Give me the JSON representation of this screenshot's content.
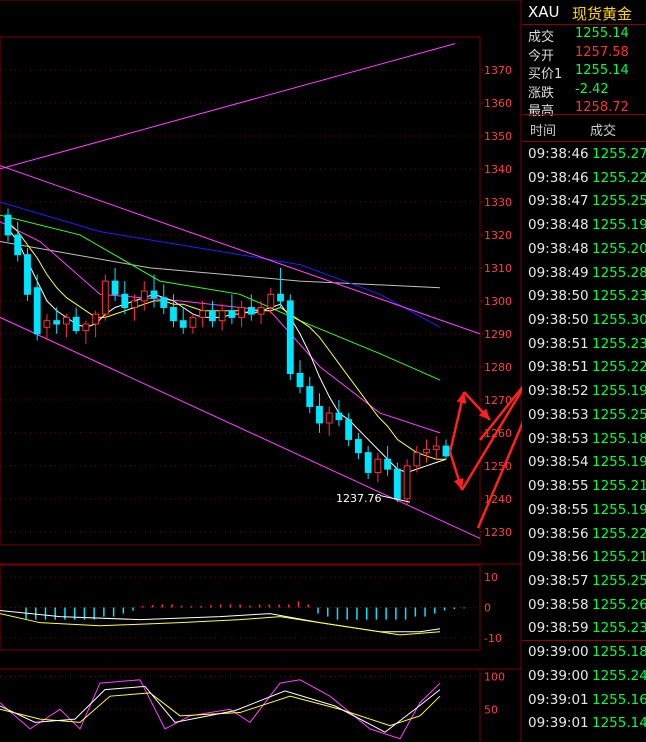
{
  "colors": {
    "up": "#ff3030",
    "down": "#00e5ff",
    "grid": "#7a0000",
    "axis_text": "#ff4040",
    "channel": "#ff40ff",
    "ma5": "#ffffff",
    "ma10": "#ffff40",
    "ma20": "#ff40ff",
    "ma30": "#30ff30",
    "ma60": "#2020ff",
    "ma120": "#c0c0c0",
    "arrow": "#ff2020",
    "value_green": "#00ff40",
    "value_red": "#ff3030"
  },
  "quote": {
    "symbol": "XAU",
    "name": "现货黄金",
    "rows": [
      {
        "label": "成交",
        "value": "1255.14",
        "color": "#00ff40"
      },
      {
        "label": "今开",
        "value": "1257.58",
        "color": "#ff3030"
      },
      {
        "label": "买价1",
        "value": "1255.14",
        "color": "#00ff40"
      },
      {
        "label": "涨跌",
        "value": "-2.42",
        "color": "#00ff40"
      },
      {
        "label": "最高",
        "value": "1258.72",
        "color": "#ff3030"
      }
    ]
  },
  "trades": {
    "header_time": "时间",
    "header_price": "成交",
    "rows": [
      {
        "time": "09:38:46",
        "price": "1255.27"
      },
      {
        "time": "09:38:46",
        "price": "1255.22"
      },
      {
        "time": "09:38:47",
        "price": "1255.25"
      },
      {
        "time": "09:38:48",
        "price": "1255.19"
      },
      {
        "time": "09:38:48",
        "price": "1255.20"
      },
      {
        "time": "09:38:49",
        "price": "1255.28"
      },
      {
        "time": "09:38:50",
        "price": "1255.23"
      },
      {
        "time": "09:38:50",
        "price": "1255.30"
      },
      {
        "time": "09:38:51",
        "price": "1255.23"
      },
      {
        "time": "09:38:51",
        "price": "1255.22"
      },
      {
        "time": "09:38:52",
        "price": "1255.19"
      },
      {
        "time": "09:38:53",
        "price": "1255.25"
      },
      {
        "time": "09:38:53",
        "price": "1255.18"
      },
      {
        "time": "09:38:54",
        "price": "1255.19"
      },
      {
        "time": "09:38:55",
        "price": "1255.21"
      },
      {
        "time": "09:38:55",
        "price": "1255.19"
      },
      {
        "time": "09:38:56",
        "price": "1255.22"
      },
      {
        "time": "09:38:56",
        "price": "1255.21"
      },
      {
        "time": "09:38:57",
        "price": "1255.25"
      },
      {
        "time": "09:38:58",
        "price": "1255.26"
      },
      {
        "time": "09:38:59",
        "price": "1255.23"
      },
      {
        "time": "09:39:00",
        "price": "1255.18"
      },
      {
        "time": "09:39:00",
        "price": "1255.24"
      },
      {
        "time": "09:39:01",
        "price": "1255.16"
      },
      {
        "time": "09:39:01",
        "price": "1255.14"
      }
    ]
  },
  "chart_data": [
    {
      "type": "candlestick",
      "ylim": [
        1226,
        1380
      ],
      "yticks": [
        1230,
        1240,
        1250,
        1260,
        1270,
        1280,
        1290,
        1300,
        1310,
        1320,
        1330,
        1340,
        1350,
        1360,
        1370
      ],
      "grid": true,
      "annotation": {
        "text": "1237.76",
        "price": 1237.76
      },
      "candles": [
        [
          1326,
          1328,
          1318,
          1320
        ],
        [
          1320,
          1324,
          1312,
          1314
        ],
        [
          1314,
          1316,
          1300,
          1302
        ],
        [
          1304,
          1308,
          1288,
          1290
        ],
        [
          1292,
          1296,
          1288,
          1294
        ],
        [
          1294,
          1298,
          1290,
          1293
        ],
        [
          1293,
          1296,
          1289,
          1295
        ],
        [
          1295,
          1298,
          1290,
          1291
        ],
        [
          1291,
          1294,
          1287,
          1293
        ],
        [
          1293,
          1297,
          1289,
          1296
        ],
        [
          1296,
          1308,
          1294,
          1306
        ],
        [
          1306,
          1310,
          1300,
          1302
        ],
        [
          1302,
          1306,
          1296,
          1298
        ],
        [
          1298,
          1302,
          1294,
          1300
        ],
        [
          1300,
          1306,
          1297,
          1303
        ],
        [
          1303,
          1308,
          1298,
          1301
        ],
        [
          1301,
          1305,
          1296,
          1298
        ],
        [
          1298,
          1302,
          1292,
          1294
        ],
        [
          1294,
          1298,
          1290,
          1292
        ],
        [
          1292,
          1296,
          1290,
          1295
        ],
        [
          1295,
          1300,
          1292,
          1297
        ],
        [
          1297,
          1300,
          1292,
          1294
        ],
        [
          1294,
          1299,
          1291,
          1297
        ],
        [
          1297,
          1302,
          1293,
          1295
        ],
        [
          1295,
          1300,
          1292,
          1298
        ],
        [
          1298,
          1302,
          1294,
          1296
        ],
        [
          1296,
          1300,
          1293,
          1298
        ],
        [
          1298,
          1304,
          1296,
          1302
        ],
        [
          1302,
          1310,
          1298,
          1300
        ],
        [
          1300,
          1302,
          1276,
          1278
        ],
        [
          1278,
          1282,
          1272,
          1274
        ],
        [
          1274,
          1277,
          1266,
          1268
        ],
        [
          1268,
          1272,
          1260,
          1263
        ],
        [
          1263,
          1268,
          1259,
          1266
        ],
        [
          1266,
          1270,
          1262,
          1264
        ],
        [
          1264,
          1266,
          1256,
          1258
        ],
        [
          1258,
          1260,
          1252,
          1254
        ],
        [
          1254,
          1256,
          1246,
          1248
        ],
        [
          1248,
          1254,
          1245,
          1252
        ],
        [
          1252,
          1256,
          1247,
          1249
        ],
        [
          1249,
          1251,
          1239,
          1240
        ],
        [
          1240,
          1252,
          1238,
          1250
        ],
        [
          1250,
          1256,
          1248,
          1254
        ],
        [
          1254,
          1258,
          1251,
          1255
        ],
        [
          1255,
          1259,
          1252,
          1256
        ],
        [
          1256,
          1258,
          1252,
          1253
        ]
      ],
      "series": [
        {
          "name": "MA5",
          "color_key": "ma5",
          "values": [
            1322,
            1318,
            1312,
            1306,
            1300,
            1297,
            1295,
            1293,
            1292,
            1293,
            1296,
            1298,
            1299,
            1300,
            1301,
            1302,
            1301,
            1300,
            1298,
            1296,
            1295,
            1295,
            1295,
            1296,
            1296,
            1297,
            1297,
            1298,
            1299,
            1295,
            1290,
            1284,
            1277,
            1271,
            1266,
            1264,
            1261,
            1258,
            1255,
            1252,
            1249,
            1248,
            1249,
            1250,
            1251,
            1252
          ]
        },
        {
          "name": "MA10",
          "color_key": "ma10",
          "values": [
            1324,
            1321,
            1317,
            1313,
            1308,
            1304,
            1301,
            1299,
            1297,
            1295,
            1295,
            1296,
            1297,
            1298,
            1299,
            1300,
            1300,
            1299,
            1299,
            1298,
            1297,
            1297,
            1297,
            1297,
            1297,
            1296,
            1297,
            1297,
            1298,
            1296,
            1294,
            1292,
            1289,
            1285,
            1281,
            1277,
            1273,
            1269,
            1265,
            1262,
            1258,
            1256,
            1254,
            1253,
            1252,
            1252
          ]
        }
      ]
    },
    {
      "type": "bar",
      "panel": "MACD",
      "ylim": [
        -14,
        14
      ],
      "yticks": [
        10,
        0,
        -10
      ],
      "values": [
        -4,
        -4,
        -4,
        -4,
        -4,
        -4,
        -4,
        -4,
        -3,
        -3,
        -2,
        -1,
        0.5,
        0.8,
        1,
        1,
        0.6,
        0.5,
        0.5,
        0.8,
        1,
        1,
        1,
        0.6,
        1,
        1,
        1,
        1,
        2,
        1,
        -2,
        -3,
        -4,
        -4,
        -4,
        -4,
        -4,
        -4,
        -4,
        -4,
        -3,
        -3,
        -2,
        -1,
        -0.5,
        -0.3
      ]
    },
    {
      "type": "line",
      "panel": "KDJ",
      "ylim": [
        0,
        110
      ],
      "yticks": [
        100,
        50
      ]
    }
  ]
}
